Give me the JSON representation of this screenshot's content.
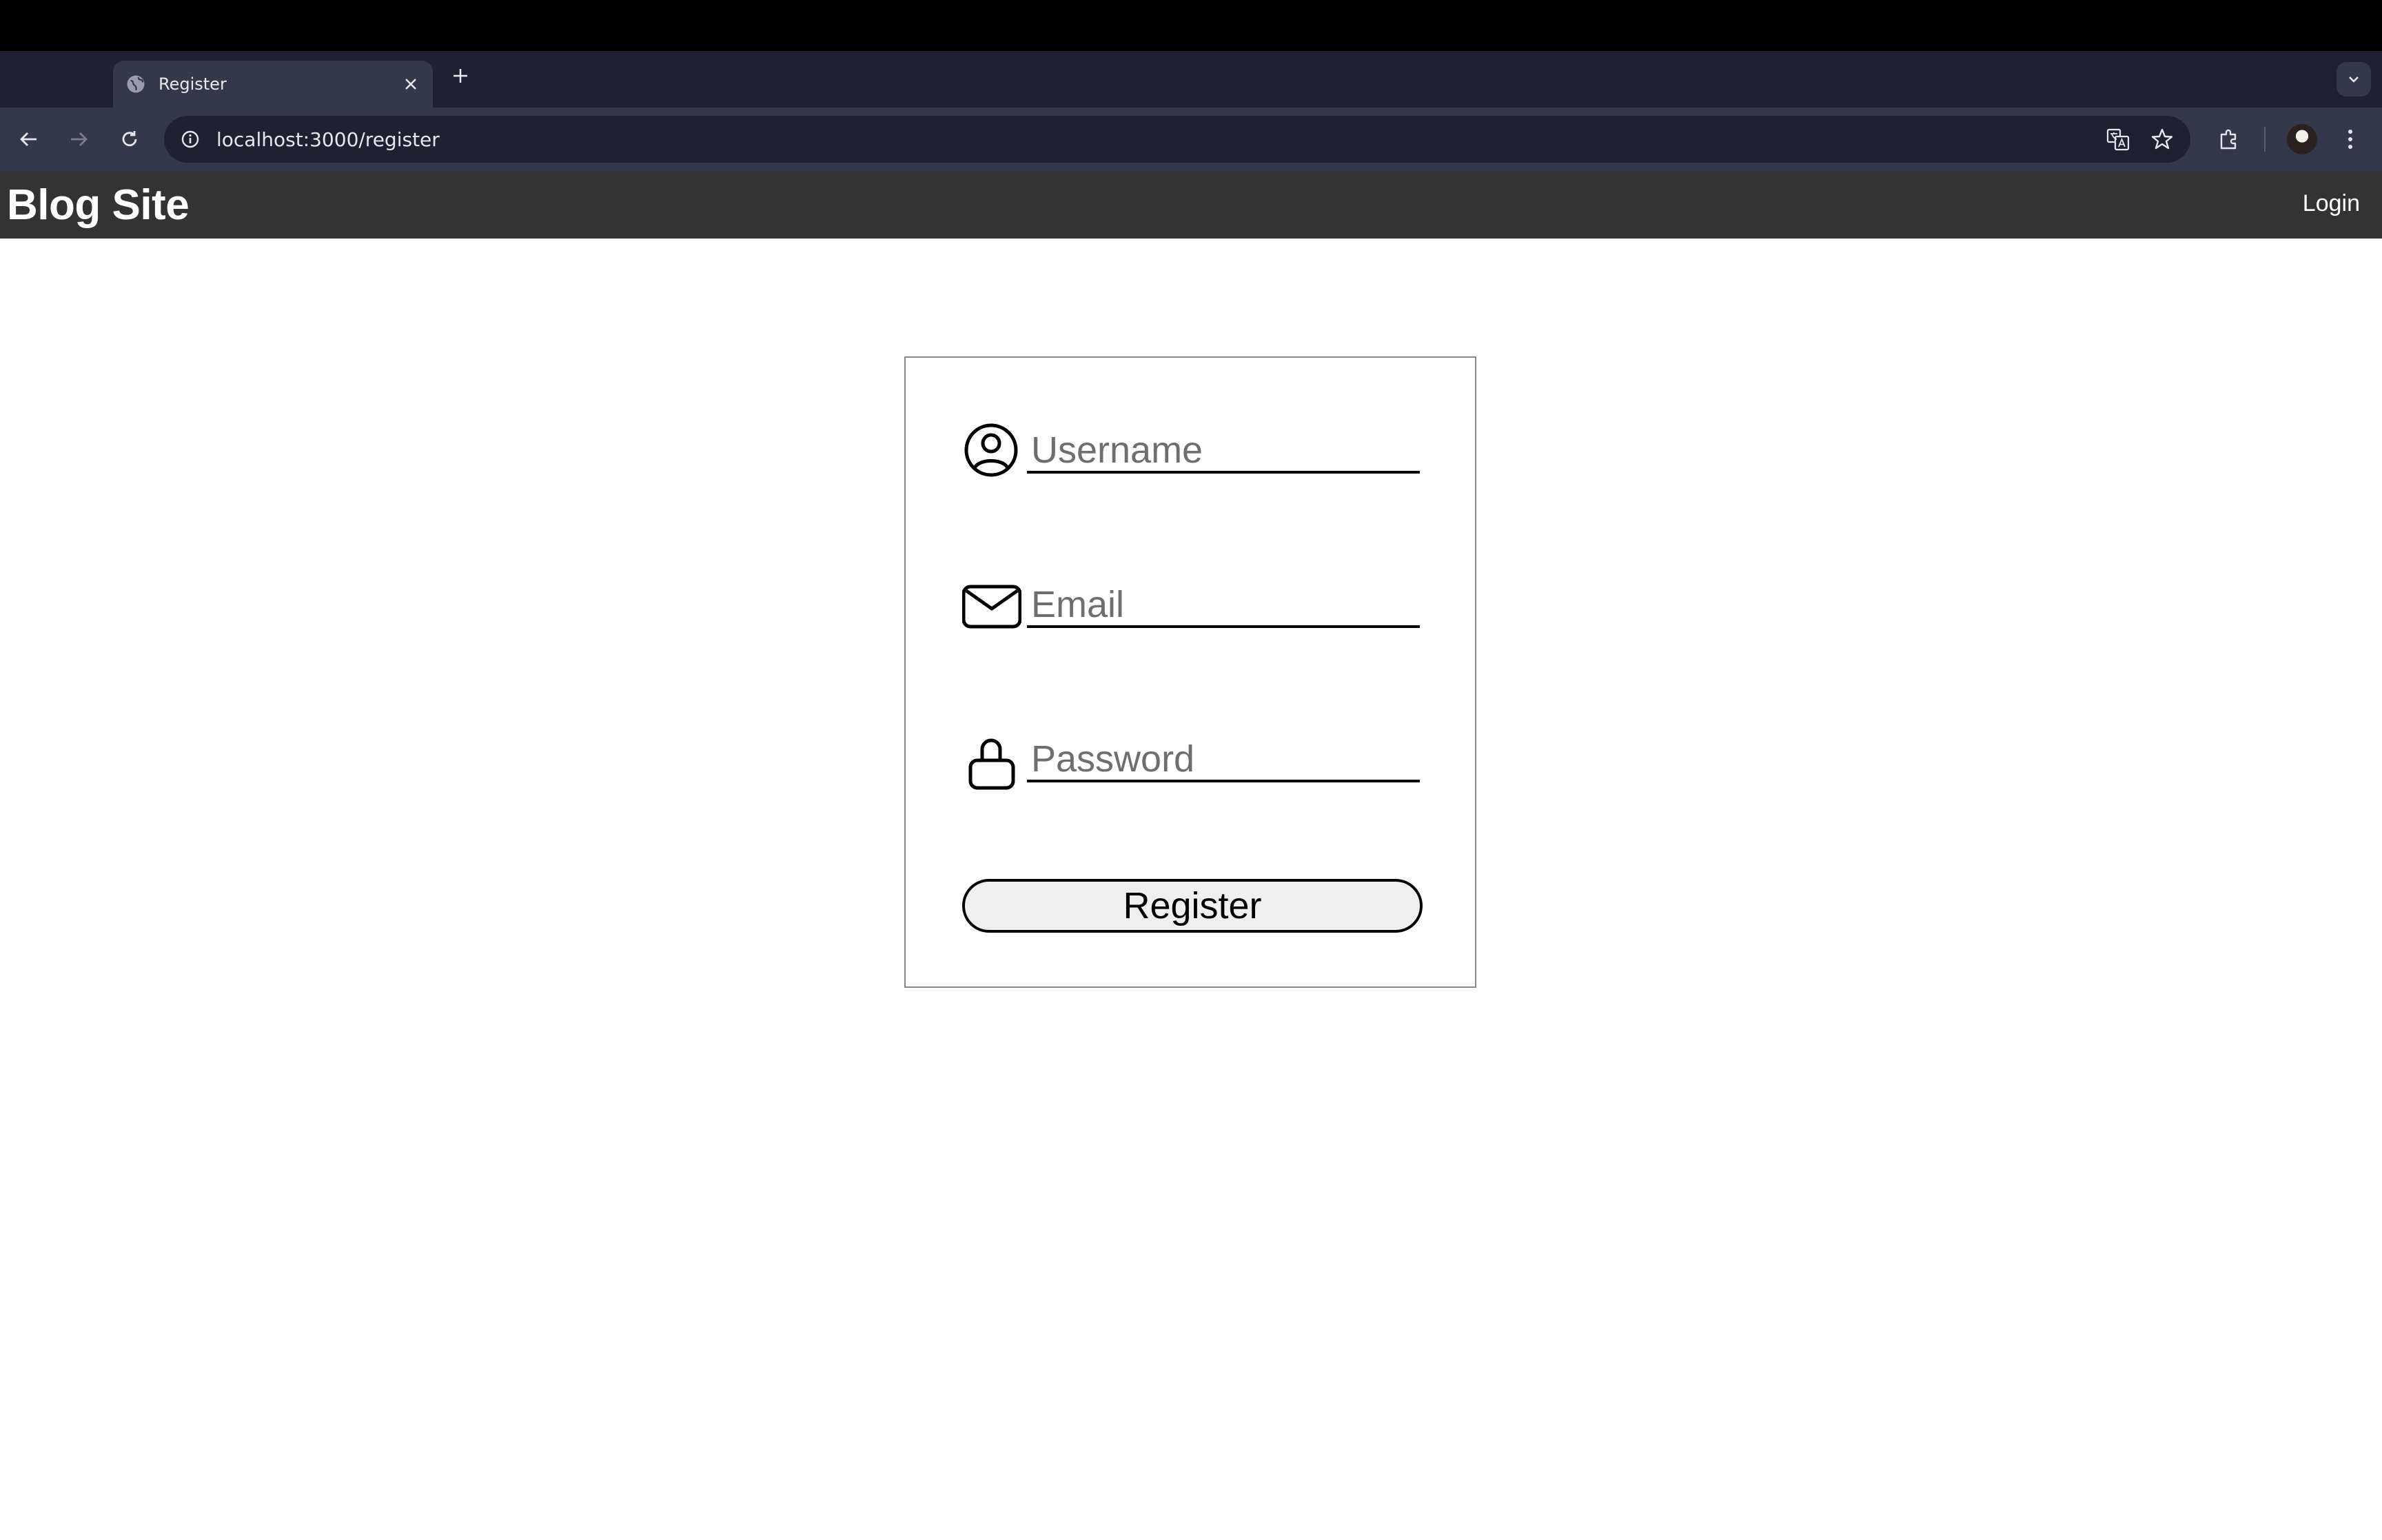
{
  "browser": {
    "tab": {
      "title": "Register"
    },
    "address_bar": {
      "url": "localhost:3000/register"
    },
    "icons": [
      "globe-icon",
      "close-icon",
      "plus-icon",
      "chevron-down-icon",
      "back-arrow-icon",
      "forward-arrow-icon",
      "reload-icon",
      "info-icon",
      "translate-icon",
      "star-icon",
      "extensions-icon",
      "menu-dots-icon"
    ],
    "colors": {
      "tabstrip": "#1f2133",
      "toolbar": "#35374a"
    }
  },
  "app": {
    "brand": "Blog Site",
    "nav": {
      "login_label": "Login"
    },
    "colors": {
      "navbar": "#333333"
    }
  },
  "form": {
    "username": {
      "placeholder": "Username",
      "value": ""
    },
    "email": {
      "placeholder": "Email",
      "value": ""
    },
    "password": {
      "placeholder": "Password",
      "value": ""
    },
    "submit_label": "Register"
  }
}
